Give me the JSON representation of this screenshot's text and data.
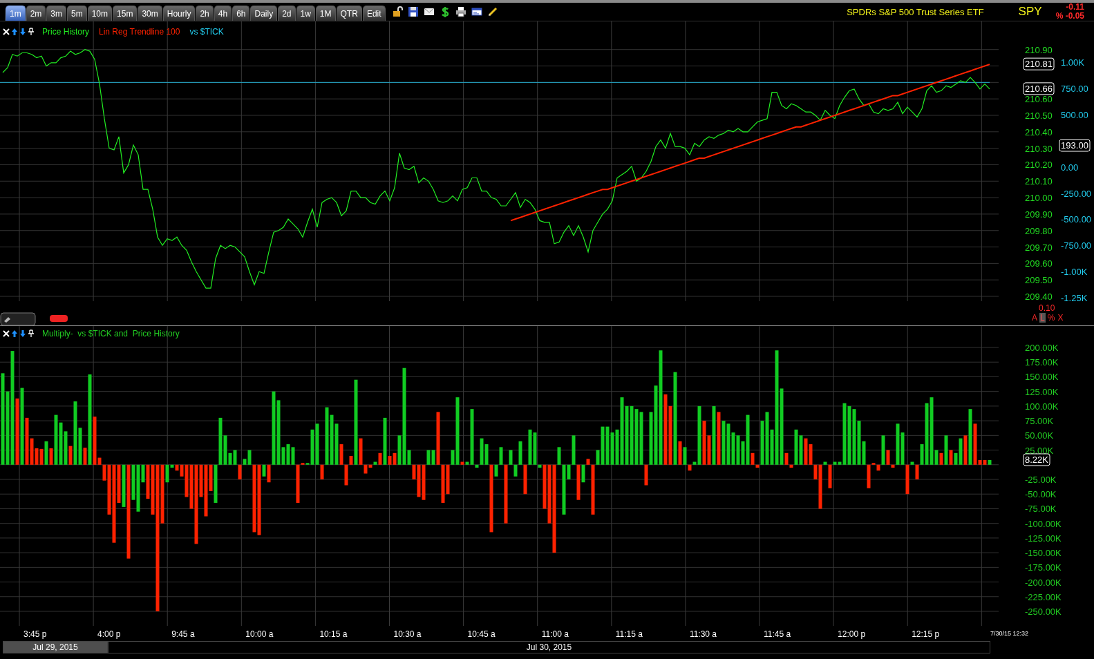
{
  "toolbar": {
    "tabs": [
      {
        "label": "1m",
        "selected": true
      },
      {
        "label": "2m",
        "selected": false
      },
      {
        "label": "3m",
        "selected": false
      },
      {
        "label": "5m",
        "selected": false
      },
      {
        "label": "10m",
        "selected": false
      },
      {
        "label": "15m",
        "selected": false
      },
      {
        "label": "30m",
        "selected": false
      },
      {
        "label": "Hourly",
        "selected": false
      },
      {
        "label": "2h",
        "selected": false
      },
      {
        "label": "4h",
        "selected": false
      },
      {
        "label": "6h",
        "selected": false
      },
      {
        "label": "Daily",
        "selected": false
      },
      {
        "label": "2d",
        "selected": false
      },
      {
        "label": "1w",
        "selected": false
      },
      {
        "label": "1M",
        "selected": false
      },
      {
        "label": "QTR",
        "selected": false
      },
      {
        "label": "Edit",
        "selected": false
      }
    ]
  },
  "instrument": {
    "name": "SPDRs S&P 500 Trust Series ETF",
    "symbol": "SPY",
    "change": "-0.11",
    "change_percent": "% -0.05"
  },
  "price_panel": {
    "chart_data": {
      "type": "line",
      "grid": true,
      "ylim": [
        209.4,
        210.9
      ],
      "yticks": [
        {
          "value": 210.9,
          "label": "210.90"
        },
        {
          "value": 210.6,
          "label": "210.60"
        },
        {
          "value": 210.5,
          "label": "210.50"
        },
        {
          "value": 210.4,
          "label": "210.40"
        },
        {
          "value": 210.3,
          "label": "210.30"
        },
        {
          "value": 210.2,
          "label": "210.20"
        },
        {
          "value": 210.1,
          "label": "210.10"
        },
        {
          "value": 210.0,
          "label": "210.00"
        },
        {
          "value": 209.9,
          "label": "209.90"
        },
        {
          "value": 209.8,
          "label": "209.80"
        },
        {
          "value": 209.7,
          "label": "209.70"
        },
        {
          "value": 209.6,
          "label": "209.60"
        },
        {
          "value": 209.5,
          "label": "209.50"
        },
        {
          "value": 209.4,
          "label": "209.40"
        }
      ],
      "series": [
        {
          "name": "Price History",
          "color": "#22ee22",
          "values": [
            210.76,
            210.79,
            210.87,
            210.86,
            210.88,
            210.88,
            210.87,
            210.85,
            210.86,
            210.8,
            210.82,
            210.82,
            210.85,
            210.86,
            210.89,
            210.87,
            210.88,
            210.9,
            210.89,
            210.84,
            210.69,
            210.48,
            210.3,
            210.29,
            210.37,
            210.15,
            210.2,
            210.32,
            210.26,
            210.05,
            210.05,
            209.93,
            209.76,
            209.71,
            209.75,
            209.74,
            209.76,
            209.71,
            209.68,
            209.61,
            209.55,
            209.5,
            209.45,
            209.45,
            209.63,
            209.71,
            209.69,
            209.71,
            209.7,
            209.67,
            209.64,
            209.55,
            209.47,
            209.55,
            209.54,
            209.67,
            209.79,
            209.8,
            209.82,
            209.87,
            209.84,
            209.81,
            209.76,
            209.85,
            209.93,
            209.82,
            209.97,
            209.99,
            210.0,
            209.97,
            209.89,
            209.92,
            210.04,
            210.04,
            210.0,
            210.0,
            209.97,
            209.96,
            210.01,
            210.04,
            209.98,
            210.06,
            210.27,
            210.18,
            210.17,
            210.19,
            210.09,
            210.12,
            210.1,
            210.05,
            209.98,
            209.97,
            209.98,
            210.01,
            209.98,
            210.05,
            210.06,
            210.12,
            210.12,
            210.04,
            210.04,
            210.0,
            209.99,
            209.95,
            209.95,
            209.99,
            210.03,
            209.94,
            209.99,
            209.97,
            209.93,
            209.86,
            209.85,
            209.85,
            209.72,
            209.73,
            209.79,
            209.83,
            209.77,
            209.83,
            209.76,
            209.67,
            209.8,
            209.85,
            209.9,
            209.93,
            209.98,
            210.12,
            210.14,
            210.16,
            210.19,
            210.1,
            210.12,
            210.16,
            210.22,
            210.31,
            210.35,
            210.3,
            210.39,
            210.31,
            210.31,
            210.3,
            210.26,
            210.33,
            210.31,
            210.35,
            210.37,
            210.36,
            210.38,
            210.39,
            210.41,
            210.4,
            210.42,
            210.4,
            210.4,
            210.43,
            210.46,
            210.47,
            210.48,
            210.64,
            210.64,
            210.56,
            210.54,
            210.57,
            210.56,
            210.54,
            210.52,
            210.52,
            210.5,
            210.47,
            210.53,
            210.5,
            210.48,
            210.56,
            210.61,
            210.65,
            210.66,
            210.6,
            210.56,
            210.57,
            210.52,
            210.51,
            210.54,
            210.53,
            210.54,
            210.58,
            210.51,
            210.55,
            210.52,
            210.49,
            210.54,
            210.65,
            210.68,
            210.64,
            210.65,
            210.68,
            210.67,
            210.69,
            210.71,
            210.7,
            210.73,
            210.7,
            210.66,
            210.69,
            210.66
          ]
        },
        {
          "name": "Lin Reg Trendline 100",
          "color": "#ff2200",
          "values": [
            null,
            null,
            null,
            null,
            null,
            null,
            null,
            null,
            null,
            null,
            null,
            null,
            null,
            null,
            null,
            null,
            null,
            null,
            null,
            null,
            null,
            null,
            null,
            null,
            null,
            null,
            null,
            null,
            null,
            null,
            null,
            null,
            null,
            null,
            null,
            null,
            null,
            null,
            null,
            null,
            null,
            null,
            null,
            null,
            null,
            null,
            null,
            null,
            null,
            null,
            null,
            null,
            null,
            null,
            null,
            null,
            null,
            null,
            null,
            null,
            null,
            null,
            null,
            null,
            null,
            null,
            null,
            null,
            null,
            null,
            null,
            null,
            null,
            null,
            null,
            null,
            null,
            null,
            null,
            null,
            null,
            null,
            null,
            null,
            null,
            null,
            null,
            null,
            null,
            null,
            null,
            null,
            null,
            null,
            null,
            null,
            null,
            null,
            null,
            null,
            null,
            null,
            null,
            null,
            null,
            209.86,
            209.87,
            209.88,
            209.89,
            209.9,
            209.91,
            209.92,
            209.93,
            209.94,
            209.95,
            209.96,
            209.97,
            209.98,
            209.99,
            210.0,
            210.01,
            210.02,
            210.03,
            210.04,
            210.05,
            210.05,
            210.06,
            210.07,
            210.08,
            210.09,
            210.1,
            210.11,
            210.12,
            210.13,
            210.14,
            210.15,
            210.16,
            210.17,
            210.18,
            210.19,
            210.2,
            210.21,
            210.22,
            210.23,
            210.24,
            210.24,
            210.25,
            210.26,
            210.27,
            210.28,
            210.29,
            210.3,
            210.31,
            210.32,
            210.33,
            210.34,
            210.35,
            210.36,
            210.37,
            210.38,
            210.39,
            210.4,
            210.41,
            210.42,
            210.43,
            210.43,
            210.44,
            210.45,
            210.46,
            210.47,
            210.48,
            210.49,
            210.5,
            210.51,
            210.52,
            210.53,
            210.54,
            210.55,
            210.56,
            210.57,
            210.58,
            210.59,
            210.6,
            210.61,
            210.62,
            210.62,
            210.63,
            210.64,
            210.65,
            210.66,
            210.67,
            210.68,
            210.69,
            210.7,
            210.71,
            210.72,
            210.73,
            210.74,
            210.75,
            210.76,
            210.77,
            210.78,
            210.79,
            210.8,
            210.81
          ]
        }
      ],
      "ref_lines": [
        {
          "axis": "y",
          "value": 210.7,
          "label": "vs $TICK",
          "color": "#22aacc"
        }
      ]
    },
    "price_badges": [
      "210.81",
      "210.66"
    ],
    "tick_axis": [
      "1.00K",
      "750.00",
      "500.00",
      "0.00",
      "-250.00",
      "-500.00",
      "-750.00",
      "-1.00K",
      "-1.25K"
    ],
    "tick_badge": "193.00",
    "scale_value": "0.10",
    "scale_buttons": [
      {
        "label": "A",
        "selected": false
      },
      {
        "label": "L",
        "selected": true
      },
      {
        "label": "%",
        "selected": false
      },
      {
        "label": "X",
        "selected": false
      }
    ]
  },
  "indicator_panel": {
    "chart_data": {
      "type": "bar",
      "grid": true,
      "ylim": [
        -250,
        200
      ],
      "yticks": [
        {
          "value": 200,
          "label": "200.00K"
        },
        {
          "value": 175,
          "label": "175.00K"
        },
        {
          "value": 150,
          "label": "150.00K"
        },
        {
          "value": 125,
          "label": "125.00K"
        },
        {
          "value": 100,
          "label": "100.00K"
        },
        {
          "value": 75,
          "label": "75.00K"
        },
        {
          "value": 50,
          "label": "50.00K"
        },
        {
          "value": 25,
          "label": "25.00K"
        },
        {
          "value": -25,
          "label": "-25.00K"
        },
        {
          "value": -50,
          "label": "-50.00K"
        },
        {
          "value": -75,
          "label": "-75.00K"
        },
        {
          "value": -100,
          "label": "-100.00K"
        },
        {
          "value": -125,
          "label": "-125.00K"
        },
        {
          "value": -150,
          "label": "-150.00K"
        },
        {
          "value": -175,
          "label": "-175.00K"
        },
        {
          "value": -200,
          "label": "-200.00K"
        },
        {
          "value": -225,
          "label": "-225.00K"
        },
        {
          "value": -250,
          "label": "-250.00K"
        }
      ],
      "series": [
        {
          "name": "Multiply-  vs $TICK and  Price History",
          "color": "#11cc22",
          "values": [
            156,
            125,
            194,
            null,
            131,
            null,
            null,
            null,
            null,
            40,
            null,
            85,
            72,
            57,
            null,
            108,
            63,
            null,
            154,
            null,
            null,
            null,
            null,
            null,
            null,
            -72,
            null,
            -60,
            -80,
            -30,
            null,
            null,
            null,
            null,
            -30,
            -5,
            null,
            null,
            null,
            null,
            null,
            null,
            null,
            null,
            -65,
            80,
            50,
            20,
            25,
            null,
            10,
            25,
            null,
            null,
            -20,
            null,
            125,
            110,
            30,
            35,
            30,
            null,
            null,
            3,
            60,
            70,
            null,
            98,
            85,
            70,
            null,
            null,
            null,
            145,
            null,
            null,
            null,
            5,
            null,
            80,
            null,
            null,
            50,
            165,
            25,
            null,
            null,
            null,
            25,
            25,
            null,
            null,
            null,
            25,
            115,
            null,
            5,
            95,
            -5,
            45,
            35,
            null,
            -20,
            30,
            null,
            25,
            -20,
            40,
            null,
            60,
            55,
            -5,
            null,
            null,
            null,
            30,
            -85,
            -25,
            50,
            null,
            -30,
            null,
            null,
            25,
            65,
            65,
            55,
            60,
            115,
            100,
            100,
            95,
            90,
            null,
            90,
            135,
            195,
            null,
            null,
            158,
            null,
            30,
            null,
            5,
            100,
            null,
            null,
            100,
            null,
            75,
            70,
            55,
            50,
            40,
            85,
            null,
            null,
            75,
            90,
            60,
            195,
            130,
            null,
            null,
            60,
            50,
            null,
            null,
            null,
            null,
            5,
            null,
            5,
            5,
            105,
            100,
            95,
            75,
            40,
            null,
            null,
            null,
            50,
            null,
            null,
            70,
            55,
            null,
            5,
            null,
            35,
            105,
            115,
            25,
            null,
            50,
            null,
            20,
            45,
            null,
            95,
            null,
            null,
            null,
            8
          ]
        },
        {
          "color": "#ff2200",
          "values": [
            null,
            null,
            null,
            113,
            null,
            80,
            45,
            28,
            27,
            null,
            28,
            null,
            null,
            null,
            32,
            null,
            null,
            29,
            null,
            82,
            12,
            -27,
            -85,
            -133,
            -65,
            null,
            -160,
            null,
            null,
            null,
            -58,
            -85,
            -250,
            -100,
            null,
            null,
            -10,
            -20,
            -55,
            -75,
            -135,
            -55,
            -88,
            -45,
            null,
            null,
            null,
            null,
            null,
            -25,
            null,
            null,
            -115,
            -120,
            null,
            -30,
            null,
            null,
            null,
            null,
            null,
            -65,
            3,
            null,
            null,
            null,
            -25,
            null,
            null,
            null,
            35,
            -35,
            15,
            null,
            45,
            -15,
            -5,
            null,
            20,
            null,
            15,
            20,
            null,
            null,
            null,
            -25,
            -55,
            -60,
            null,
            null,
            90,
            -65,
            -50,
            null,
            null,
            5,
            null,
            null,
            null,
            null,
            null,
            -115,
            null,
            null,
            -100,
            null,
            null,
            null,
            -50,
            null,
            null,
            null,
            -75,
            -100,
            -150,
            null,
            null,
            null,
            null,
            -60,
            null,
            10,
            -85,
            null,
            null,
            null,
            null,
            null,
            null,
            null,
            null,
            null,
            null,
            -35,
            null,
            null,
            null,
            120,
            100,
            null,
            40,
            null,
            -10,
            null,
            null,
            75,
            50,
            null,
            90,
            null,
            null,
            null,
            null,
            null,
            null,
            20,
            -5,
            null,
            null,
            null,
            null,
            null,
            20,
            -5,
            null,
            null,
            45,
            35,
            -25,
            -75,
            null,
            -40,
            null,
            null,
            null,
            null,
            null,
            null,
            null,
            -40,
            3,
            -10,
            null,
            25,
            -5,
            null,
            null,
            -50,
            null,
            -25,
            null,
            null,
            null,
            null,
            20,
            null,
            25,
            null,
            null,
            50,
            null,
            70,
            8,
            8,
            null
          ]
        }
      ]
    },
    "value_badge": "8.22K"
  },
  "time_axis": {
    "labels": [
      "3:45 p",
      "4:00 p",
      "9:45 a",
      "10:00 a",
      "10:15 a",
      "10:30 a",
      "10:45 a",
      "11:00 a",
      "11:15 a",
      "11:30 a",
      "11:45 a",
      "12:00 p",
      "12:15 p"
    ],
    "timestamp": "7/30/15 12:32"
  },
  "date_bar": [
    {
      "label": "Jul 29, 2015",
      "selected": true
    },
    {
      "label": "Jul 30, 2015",
      "selected": false
    }
  ]
}
